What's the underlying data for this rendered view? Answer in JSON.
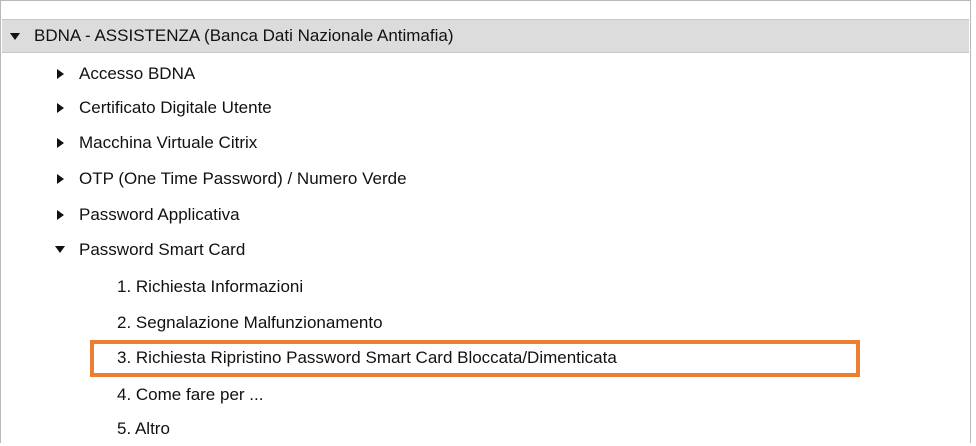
{
  "tree": {
    "root": {
      "label": "BDNA - ASSISTENZA (Banca Dati Nazionale Antimafia)",
      "expanded": true
    },
    "categories": [
      {
        "label": "Accesso BDNA",
        "expanded": false
      },
      {
        "label": "Certificato Digitale Utente",
        "expanded": false
      },
      {
        "label": "Macchina Virtuale Citrix",
        "expanded": false
      },
      {
        "label": "OTP (One Time Password) / Numero Verde",
        "expanded": false
      },
      {
        "label": "Password Applicativa",
        "expanded": false
      },
      {
        "label": "Password Smart Card",
        "expanded": true
      }
    ],
    "subitems": [
      {
        "label": "1. Richiesta Informazioni"
      },
      {
        "label": "2. Segnalazione Malfunzionamento"
      },
      {
        "label": "3. Richiesta Ripristino Password Smart Card Bloccata/Dimenticata",
        "highlighted": true
      },
      {
        "label": "4. Come fare per ..."
      },
      {
        "label": "5. Altro"
      }
    ]
  },
  "colors": {
    "root_background": "#dcdcdc",
    "highlight_border": "#ed7d31",
    "text": "#111111"
  }
}
